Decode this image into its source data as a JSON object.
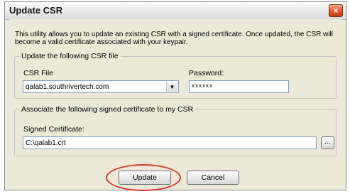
{
  "window": {
    "title": "Update CSR",
    "close_glyph": "×"
  },
  "description": "This utility allows you to update an existing CSR with a signed certificate. Once updated, the CSR will become a valid certificate associated with your keypair.",
  "csr_group": {
    "legend": "Update the following CSR file",
    "csr_file_label": "CSR File",
    "csr_file_value": "qalab1.southrivertech.com",
    "password_label": "Password:",
    "password_value": "xxxxxx"
  },
  "cert_group": {
    "legend": "Associate the following signed certificate to my CSR",
    "signed_cert_label": "Signed Certificate:",
    "signed_cert_value": "C:\\qalab1.crt",
    "browse_label": "..."
  },
  "buttons": {
    "update": "Update",
    "cancel": "Cancel"
  },
  "icons": {
    "close": "close-icon",
    "dropdown": "chevron-down-icon"
  },
  "colors": {
    "highlight": "#d63a31",
    "close_button": "#e0552d"
  }
}
